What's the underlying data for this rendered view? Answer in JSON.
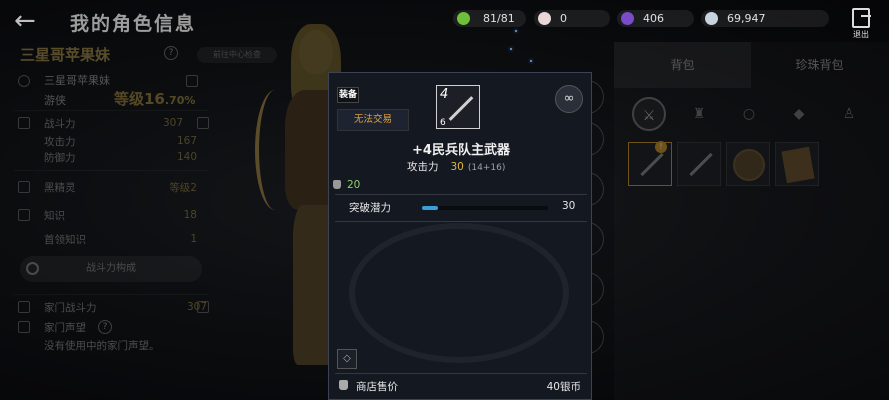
{
  "header": {
    "title": "我的角色信息",
    "resources": [
      {
        "name": "vigor",
        "value": "81/81",
        "icon": "leaf-icon",
        "color": "#6fbf3a"
      },
      {
        "name": "pearls",
        "value": "0",
        "icon": "pearl-icon",
        "color": "#e9d7d7"
      },
      {
        "name": "black-crystal",
        "value": "406",
        "icon": "crystal-icon",
        "color": "#7b4cc9"
      },
      {
        "name": "silver",
        "value": "69,947",
        "icon": "silver-coin-icon",
        "color": "#c7d4e0"
      }
    ],
    "exit_label": "退出"
  },
  "left_panel": {
    "character_name": "三星哥苹果妹",
    "name_badge": "前往中心检查",
    "family_name": "三星哥苹果妹",
    "class_name": "游侠",
    "level_label": "等级16",
    "level_percent": ".70%",
    "stats": [
      {
        "label": "战斗力",
        "value": "307"
      },
      {
        "label": "攻击力",
        "value": "167"
      },
      {
        "label": "防御力",
        "value": "140"
      }
    ],
    "black_spirit": {
      "label": "黑精灵",
      "value": "等级2"
    },
    "knowledge": {
      "label": "知识",
      "value": "18"
    },
    "first_knowledge": {
      "label": "首领知识",
      "value": "1"
    },
    "power_button": "战斗力构成",
    "family_power": {
      "label": "家门战斗力",
      "value": "307"
    },
    "family_fame": {
      "label": "家门声望"
    },
    "family_note": "没有使用中的家门声望。"
  },
  "right_panel": {
    "tabs": [
      "背包",
      "珍珠背包"
    ],
    "active_tab": 0
  },
  "tooltip": {
    "equip_tag": "装备",
    "trade_status": "无法交易",
    "enhance": "4",
    "grade": "6",
    "item_name": "+4民兵队主武器",
    "attack_label": "攻击力",
    "attack_value": "30",
    "attack_detail": "(14+16)",
    "weight": "20",
    "potential_label": "突破潜力",
    "potential_value": "30",
    "potential_fill": 0.13,
    "sell_label": "商店售价",
    "sell_value": "40银币"
  }
}
